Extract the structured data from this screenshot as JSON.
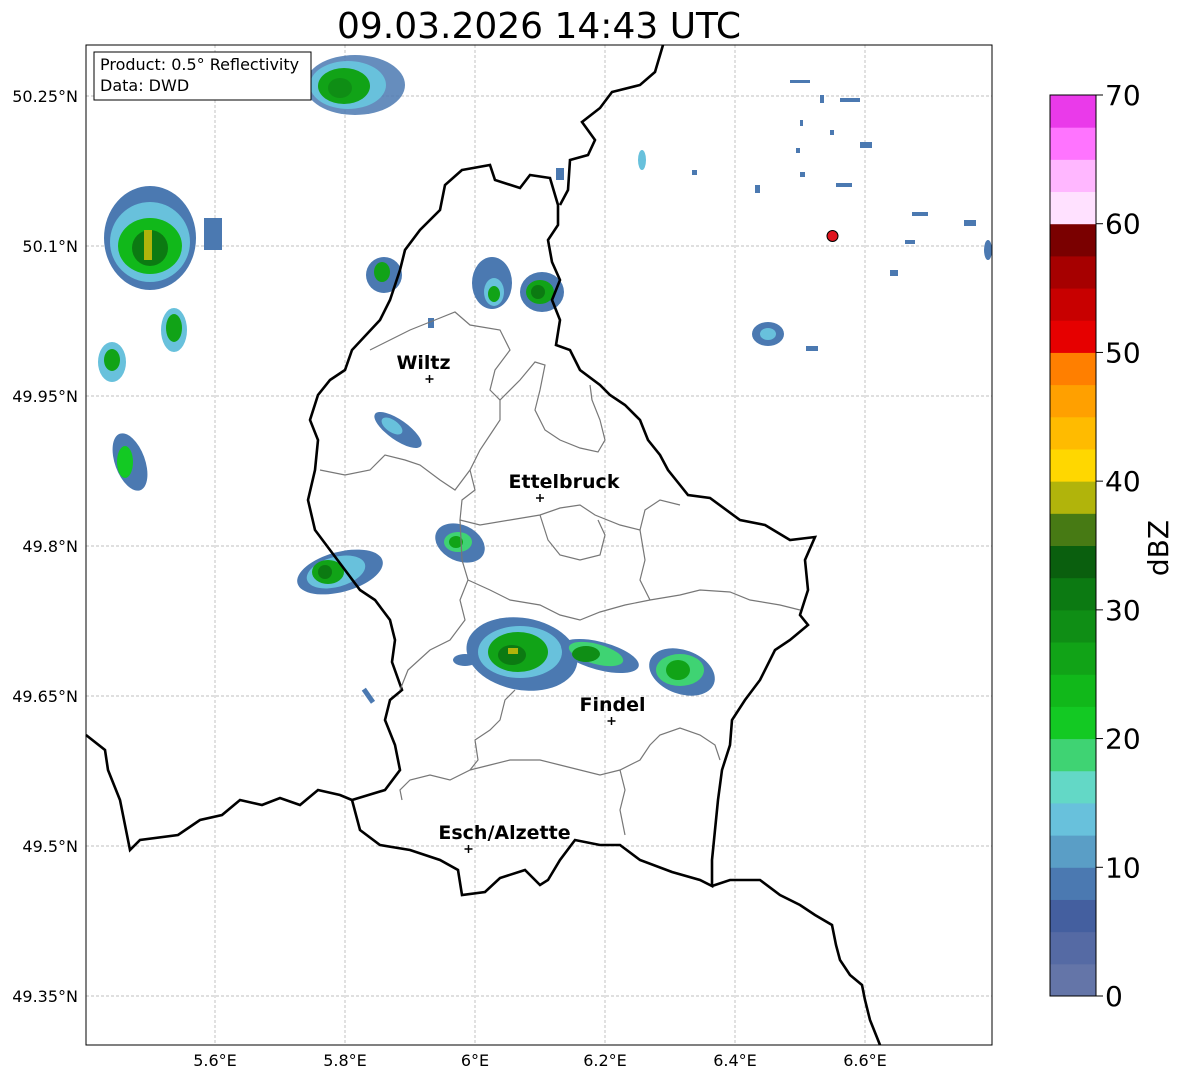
{
  "title": "09.03.2026 14:43 UTC",
  "info_box": {
    "line1": "Product: 0.5° Reflectivity",
    "line2": "Data: DWD"
  },
  "lon_ticks": [
    "5.6°E",
    "5.8°E",
    "6°E",
    "6.2°E",
    "6.4°E",
    "6.6°E"
  ],
  "lat_ticks": [
    "50.25°N",
    "50.1°N",
    "49.95°N",
    "49.8°N",
    "49.65°N",
    "49.5°N",
    "49.35°N"
  ],
  "colorbar": {
    "label": "dBZ",
    "ticks": [
      "0",
      "10",
      "20",
      "30",
      "40",
      "50",
      "60",
      "70"
    ],
    "colors": [
      "#6475a8",
      "#556aa4",
      "#445f9f",
      "#4b79b1",
      "#5a9ec6",
      "#68c1dc",
      "#63d8c6",
      "#3fd373",
      "#13c923",
      "#11b81a",
      "#11a317",
      "#0f8e15",
      "#0c7a12",
      "#0a5f0e",
      "#477a14",
      "#b1b40b",
      "#ffd700",
      "#ffbb00",
      "#ffa000",
      "#ff7f00",
      "#e60000",
      "#c80000",
      "#a60000",
      "#7a0000",
      "#ffe1ff",
      "#ffb7ff",
      "#ff74ff",
      "#ea3aea"
    ]
  },
  "cities": [
    {
      "name": "Wiltz",
      "lon": 5.93,
      "lat": 49.967
    },
    {
      "name": "Ettelbruck",
      "lon": 6.1,
      "lat": 49.848
    },
    {
      "name": "Findel",
      "lon": 6.21,
      "lat": 49.625
    },
    {
      "name": "Esch/Alzette",
      "lon": 5.99,
      "lat": 49.497
    }
  ],
  "marker": {
    "lon": 6.55,
    "lat": 50.11,
    "color": "#e0141e"
  }
}
